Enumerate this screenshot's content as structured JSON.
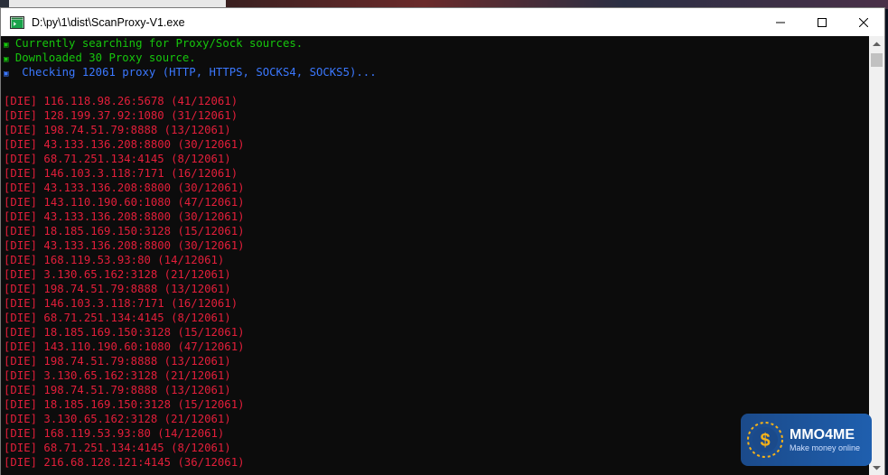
{
  "window": {
    "title": "D:\\py\\1\\dist\\ScanProxy-V1.exe"
  },
  "console": {
    "status_lines": [
      {
        "bullet": "▣",
        "text": " Currently searching for Proxy/Sock sources.",
        "color": "green"
      },
      {
        "bullet": "▣",
        "text": " Downloaded 30 Proxy source.",
        "color": "green"
      },
      {
        "bullet": "▣",
        "text": "  Checking 12061 proxy (HTTP, HTTPS, SOCKS4, SOCKS5)...",
        "color": "blue"
      }
    ],
    "results": [
      "[DIE] 116.118.98.26:5678 (41/12061)",
      "[DIE] 128.199.37.92:1080 (31/12061)",
      "[DIE] 198.74.51.79:8888 (13/12061)",
      "[DIE] 43.133.136.208:8800 (30/12061)",
      "[DIE] 68.71.251.134:4145 (8/12061)",
      "[DIE] 146.103.3.118:7171 (16/12061)",
      "[DIE] 43.133.136.208:8800 (30/12061)",
      "[DIE] 143.110.190.60:1080 (47/12061)",
      "[DIE] 43.133.136.208:8800 (30/12061)",
      "[DIE] 18.185.169.150:3128 (15/12061)",
      "[DIE] 43.133.136.208:8800 (30/12061)",
      "[DIE] 168.119.53.93:80 (14/12061)",
      "[DIE] 3.130.65.162:3128 (21/12061)",
      "[DIE] 198.74.51.79:8888 (13/12061)",
      "[DIE] 146.103.3.118:7171 (16/12061)",
      "[DIE] 68.71.251.134:4145 (8/12061)",
      "[DIE] 18.185.169.150:3128 (15/12061)",
      "[DIE] 143.110.190.60:1080 (47/12061)",
      "[DIE] 198.74.51.79:8888 (13/12061)",
      "[DIE] 3.130.65.162:3128 (21/12061)",
      "[DIE] 198.74.51.79:8888 (13/12061)",
      "[DIE] 18.185.169.150:3128 (15/12061)",
      "[DIE] 3.130.65.162:3128 (21/12061)",
      "[DIE] 168.119.53.93:80 (14/12061)",
      "[DIE] 68.71.251.134:4145 (8/12061)",
      "[DIE] 216.68.128.121:4145 (36/12061)"
    ]
  },
  "watermark": {
    "name": "MMO4ME",
    "tagline": "Make money online"
  },
  "colors": {
    "green": "#16c60c",
    "blue": "#3b78ff",
    "red": "#e31e3a",
    "console_bg": "#0c0c0c"
  }
}
